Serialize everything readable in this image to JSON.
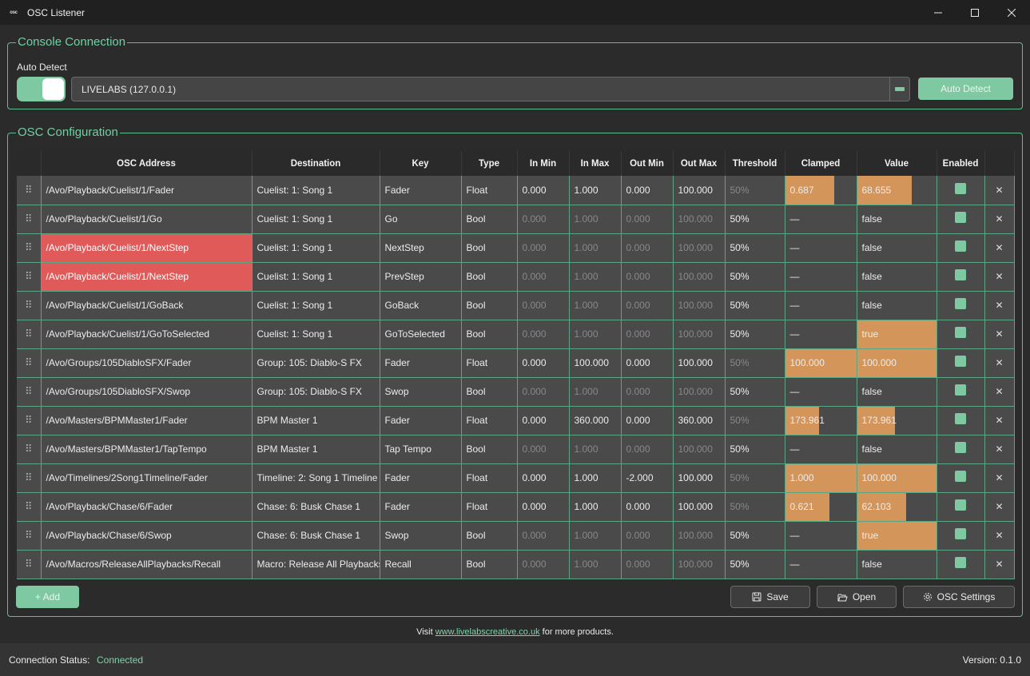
{
  "window": {
    "title": "OSC Listener",
    "icon_text": "osc"
  },
  "console": {
    "group_title": "Console Connection",
    "auto_detect_label": "Auto Detect",
    "toggle_on": true,
    "selected_console": "LIVELABS (127.0.0.1)",
    "auto_detect_button": "Auto Detect"
  },
  "osc": {
    "group_title": "OSC Configuration",
    "columns": [
      "",
      "OSC Address",
      "Destination",
      "Key",
      "Type",
      "In Min",
      "In Max",
      "Out Min",
      "Out Max",
      "Threshold",
      "Clamped",
      "Value",
      "Enabled",
      ""
    ],
    "rows": [
      {
        "address": "/Avo/Playback/Cuelist/1/Fader",
        "destination": "Cuelist: 1: Song 1",
        "key": "Fader",
        "type": "Float",
        "in_min": "0.000",
        "in_max": "1.000",
        "out_min": "0.000",
        "out_max": "100.000",
        "threshold": "50%",
        "clamped": "0.687",
        "clamped_level": 0.687,
        "value": "68.655",
        "value_level": 0.687,
        "enabled": true,
        "error": false
      },
      {
        "address": "/Avo/Playback/Cuelist/1/Go",
        "destination": "Cuelist: 1: Song 1",
        "key": "Go",
        "type": "Bool",
        "in_min": "0.000",
        "in_max": "1.000",
        "out_min": "0.000",
        "out_max": "100.000",
        "threshold": "50%",
        "clamped": "—",
        "clamped_level": 0,
        "value": "false",
        "value_level": 0,
        "enabled": true,
        "error": false
      },
      {
        "address": "/Avo/Playback/Cuelist/1/NextStep",
        "destination": "Cuelist: 1: Song 1",
        "key": "NextStep",
        "type": "Bool",
        "in_min": "0.000",
        "in_max": "1.000",
        "out_min": "0.000",
        "out_max": "100.000",
        "threshold": "50%",
        "clamped": "—",
        "clamped_level": 0,
        "value": "false",
        "value_level": 0,
        "enabled": true,
        "error": true
      },
      {
        "address": "/Avo/Playback/Cuelist/1/NextStep",
        "destination": "Cuelist: 1: Song 1",
        "key": "PrevStep",
        "type": "Bool",
        "in_min": "0.000",
        "in_max": "1.000",
        "out_min": "0.000",
        "out_max": "100.000",
        "threshold": "50%",
        "clamped": "—",
        "clamped_level": 0,
        "value": "false",
        "value_level": 0,
        "enabled": true,
        "error": true
      },
      {
        "address": "/Avo/Playback/Cuelist/1/GoBack",
        "destination": "Cuelist: 1: Song 1",
        "key": "GoBack",
        "type": "Bool",
        "in_min": "0.000",
        "in_max": "1.000",
        "out_min": "0.000",
        "out_max": "100.000",
        "threshold": "50%",
        "clamped": "—",
        "clamped_level": 0,
        "value": "false",
        "value_level": 0,
        "enabled": true,
        "error": false
      },
      {
        "address": "/Avo/Playback/Cuelist/1/GoToSelected",
        "destination": "Cuelist: 1: Song 1",
        "key": "GoToSelected",
        "type": "Bool",
        "in_min": "0.000",
        "in_max": "1.000",
        "out_min": "0.000",
        "out_max": "100.000",
        "threshold": "50%",
        "clamped": "—",
        "clamped_level": 0,
        "value": "true",
        "value_level": 1,
        "enabled": true,
        "error": false
      },
      {
        "address": "/Avo/Groups/105DiabloSFX/Fader",
        "destination": "Group: 105: Diablo-S FX",
        "key": "Fader",
        "type": "Float",
        "in_min": "0.000",
        "in_max": "100.000",
        "out_min": "0.000",
        "out_max": "100.000",
        "threshold": "50%",
        "clamped": "100.000",
        "clamped_level": 1,
        "value": "100.000",
        "value_level": 1,
        "enabled": true,
        "error": false
      },
      {
        "address": "/Avo/Groups/105DiabloSFX/Swop",
        "destination": "Group: 105: Diablo-S FX",
        "key": "Swop",
        "type": "Bool",
        "in_min": "0.000",
        "in_max": "1.000",
        "out_min": "0.000",
        "out_max": "100.000",
        "threshold": "50%",
        "clamped": "—",
        "clamped_level": 0,
        "value": "false",
        "value_level": 0,
        "enabled": true,
        "error": false
      },
      {
        "address": "/Avo/Masters/BPMMaster1/Fader",
        "destination": "BPM Master 1",
        "key": "Fader",
        "type": "Float",
        "in_min": "0.000",
        "in_max": "360.000",
        "out_min": "0.000",
        "out_max": "360.000",
        "threshold": "50%",
        "clamped": "173.961",
        "clamped_level": 0.483,
        "value": "173.961",
        "value_level": 0.483,
        "enabled": true,
        "error": false
      },
      {
        "address": "/Avo/Masters/BPMMaster1/TapTempo",
        "destination": "BPM Master 1",
        "key": "Tap Tempo",
        "type": "Bool",
        "in_min": "0.000",
        "in_max": "1.000",
        "out_min": "0.000",
        "out_max": "100.000",
        "threshold": "50%",
        "clamped": "—",
        "clamped_level": 0,
        "value": "false",
        "value_level": 0,
        "enabled": true,
        "error": false
      },
      {
        "address": "/Avo/Timelines/2Song1Timeline/Fader",
        "destination": "Timeline: 2: Song 1 Timeline",
        "key": "Fader",
        "type": "Float",
        "in_min": "0.000",
        "in_max": "1.000",
        "out_min": "-2.000",
        "out_max": "100.000",
        "threshold": "50%",
        "clamped": "1.000",
        "clamped_level": 1,
        "value": "100.000",
        "value_level": 1,
        "enabled": true,
        "error": false
      },
      {
        "address": "/Avo/Playback/Chase/6/Fader",
        "destination": "Chase: 6: Busk Chase 1",
        "key": "Fader",
        "type": "Float",
        "in_min": "0.000",
        "in_max": "1.000",
        "out_min": "0.000",
        "out_max": "100.000",
        "threshold": "50%",
        "clamped": "0.621",
        "clamped_level": 0.621,
        "value": "62.103",
        "value_level": 0.621,
        "enabled": true,
        "error": false
      },
      {
        "address": "/Avo/Playback/Chase/6/Swop",
        "destination": "Chase: 6: Busk Chase 1",
        "key": "Swop",
        "type": "Bool",
        "in_min": "0.000",
        "in_max": "1.000",
        "out_min": "0.000",
        "out_max": "100.000",
        "threshold": "50%",
        "clamped": "—",
        "clamped_level": 0,
        "value": "true",
        "value_level": 1,
        "enabled": true,
        "error": false
      },
      {
        "address": "/Avo/Macros/ReleaseAllPlaybacks/Recall",
        "destination": "Macro: Release All Playbacks",
        "key": "Recall",
        "type": "Bool",
        "in_min": "0.000",
        "in_max": "1.000",
        "out_min": "0.000",
        "out_max": "100.000",
        "threshold": "50%",
        "clamped": "—",
        "clamped_level": 0,
        "value": "false",
        "value_level": 0,
        "enabled": true,
        "error": false
      }
    ],
    "add_button": "+ Add",
    "save_button": "Save",
    "open_button": "Open",
    "settings_button": "OSC Settings"
  },
  "footer": {
    "visit_prefix": "Visit",
    "visit_link": "www.livelabscreative.co.uk",
    "visit_suffix": "for more products."
  },
  "status": {
    "label": "Connection Status:",
    "value": "Connected",
    "version": "Version: 0.1.0"
  },
  "colors": {
    "accent": "#7fc9a2",
    "bar_fill": "#d4955a",
    "error": "#e05a5a"
  }
}
